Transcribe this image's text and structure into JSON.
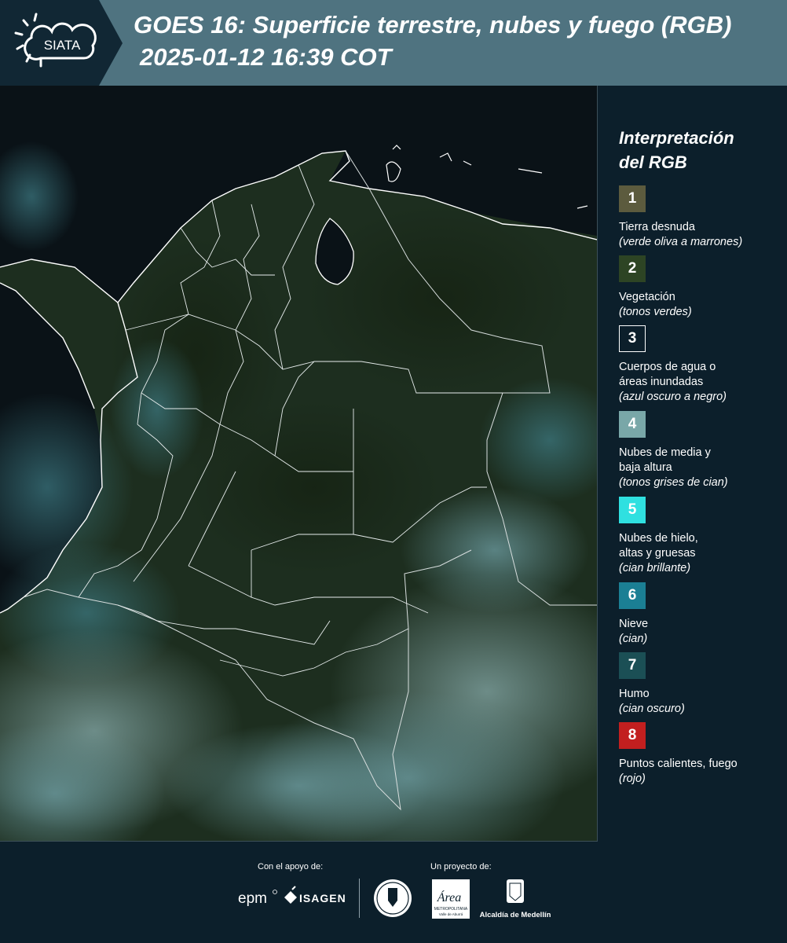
{
  "header": {
    "logo_text": "SIATA",
    "title": "GOES 16: Superficie terrestre, nubes y fuego (RGB)",
    "datetime": "2025-01-12 16:39 COT"
  },
  "legend": {
    "title_line1": "Interpretación",
    "title_line2": "del RGB",
    "items": [
      {
        "number": "1",
        "color": "#5c5b3e",
        "name_lines": [
          "Tierra desnuda"
        ],
        "description": "(verde oliva a marrones)"
      },
      {
        "number": "2",
        "color": "#2d4424",
        "name_lines": [
          "Vegetación"
        ],
        "description": "(tonos verdes)"
      },
      {
        "number": "3",
        "color": "#0c1f2b",
        "name_lines": [
          "Cuerpos de agua o",
          "áreas inundadas"
        ],
        "description": "(azul oscuro a negro)"
      },
      {
        "number": "4",
        "color": "#79a7a8",
        "name_lines": [
          "Nubes de media y",
          "baja altura"
        ],
        "description": "(tonos grises de cian)"
      },
      {
        "number": "5",
        "color": "#2fe0e0",
        "name_lines": [
          "Nubes de hielo,",
          "altas y gruesas"
        ],
        "description": "(cian brillante)"
      },
      {
        "number": "6",
        "color": "#1b7f94",
        "name_lines": [
          "Nieve"
        ],
        "description": "(cian)"
      },
      {
        "number": "7",
        "color": "#1b4f55",
        "name_lines": [
          "Humo"
        ],
        "description": "(cian oscuro)"
      },
      {
        "number": "8",
        "color": "#c21f1f",
        "name_lines": [
          "Puntos calientes, fuego"
        ],
        "description": "(rojo)"
      }
    ]
  },
  "footer": {
    "support_label": "Con el apoyo de:",
    "project_label": "Un proyecto de:",
    "sponsor1": "epm",
    "sponsor2": "ISAGEN",
    "partner_area": "Área",
    "partner_area_sub1": "METROPOLITANA",
    "partner_area_sub2": "Valle de Aburrá",
    "partner_medellin": "Alcaldía de Medellín"
  }
}
